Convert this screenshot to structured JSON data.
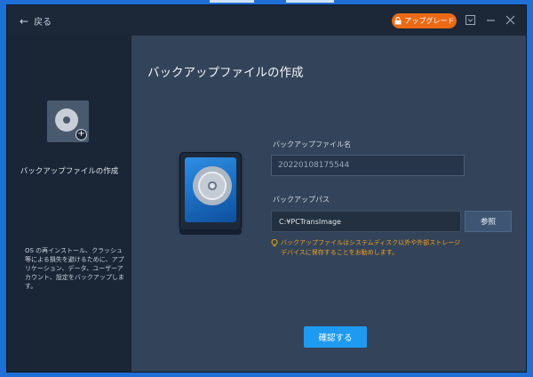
{
  "titlebar": {
    "back_label": "戻る",
    "upgrade_label": "アップグレード",
    "colors": {
      "upgrade": "#ea6a16",
      "accent": "#1e9bf0"
    }
  },
  "sidebar": {
    "title": "バックアップファイルの作成",
    "description": "OS の再インストール、クラッシュ等による損失を避けるために、アプリケーション、データ、ユーザーアカウント、設定をバックアップします。"
  },
  "main": {
    "page_title": "バックアップファイルの作成",
    "filename_label": "バックアップファイル名",
    "filename_value": "20220108175544",
    "path_label": "バックアップパス",
    "path_value": "C:¥PCTransImage",
    "browse_label": "参照",
    "note": "バックアップファイルはシステムディスク以外や外部ストレージデバイスに保存することをお勧めします。",
    "confirm_label": "確認する"
  },
  "icons": [
    "back-arrow-icon",
    "lock-icon",
    "menu-icon",
    "minimize-icon",
    "close-icon",
    "backup-disk-icon",
    "lightbulb-icon"
  ]
}
